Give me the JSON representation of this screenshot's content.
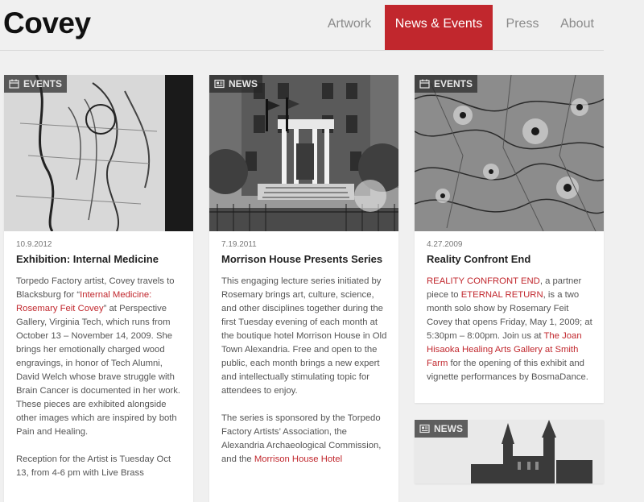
{
  "site": {
    "logo": "Covey"
  },
  "nav": {
    "items": [
      {
        "label": "Artwork",
        "active": false
      },
      {
        "label": "News & Events",
        "active": true
      },
      {
        "label": "Press",
        "active": false
      },
      {
        "label": "About",
        "active": false
      }
    ]
  },
  "colors": {
    "accent": "#c1272d",
    "background": "#f0f0f0"
  },
  "cards": [
    {
      "badge": "EVENTS",
      "badge_icon": "calendar-icon",
      "date": "10.9.2012",
      "title": "Exhibition: Internal Medicine",
      "p1_a": "Torpedo Factory  artist, Covey travels to  Blacksburg for “",
      "p1_link": "Internal Medicine: Rosemary Feit Covey",
      "p1_b": "” at Perspective Gallery, Virginia Tech, which runs from October 13 – November 14, 2009. She brings her emotionally charged wood engravings, in honor of  Tech Alumni, David Welch whose brave struggle with Brain Cancer is documented in her work. These pieces are exhibited alongside other images which are inspired by both Pain and Healing.",
      "p2": "Reception for the Artist is Tuesday Oct 13, from 4-6 pm with Live Brass"
    },
    {
      "badge": "NEWS",
      "badge_icon": "newspaper-icon",
      "date": "7.19.2011",
      "title": "Morrison House Presents Series",
      "p1": "This engaging lecture series initiated by Rosemary brings art, culture, science, and other disciplines together during the first Tuesday evening of each month at the boutique hotel Morrison House in Old Town Alexandria. Free and open to the public, each month brings a new expert and intellectually stimulating topic for attendees to enjoy.",
      "p2_a": "The series is sponsored by the Torpedo Factory Artists’ Association, the Alexandria Archaeological Commission, and the ",
      "p2_link": "Morrison House Hotel"
    },
    {
      "badge": "EVENTS",
      "badge_icon": "calendar-icon",
      "date": "4.27.2009",
      "title": "Reality Confront End",
      "link1": "REALITY CONFRONT END",
      "t1": ", a partner piece to ",
      "link2": "ETERNAL RETURN",
      "t2": ", is a two month solo show by Rosemary Feit Covey that opens Friday, May 1, 2009; at 5:30pm – 8:00pm. Join us at ",
      "link3": "The Joan Hisaoka Healing Arts Gallery at Smith  Farm",
      "t3": " for the opening of this exhibit and vignette performances by BosmaDance."
    },
    {
      "badge": "NEWS",
      "badge_icon": "newspaper-icon"
    }
  ]
}
